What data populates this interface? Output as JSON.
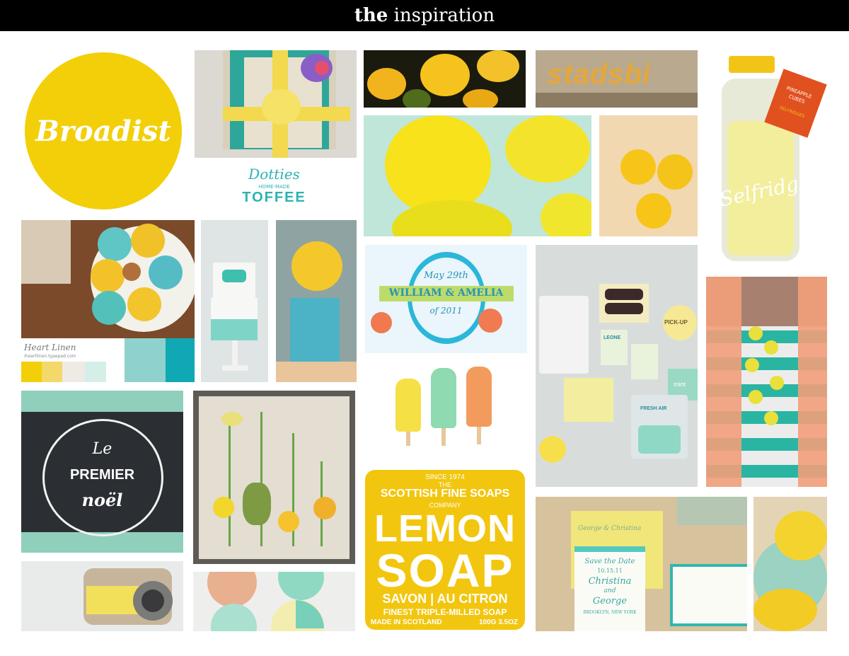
{
  "header": {
    "bold": "the",
    "rest": "inspiration"
  },
  "logo": {
    "text": "Broadist",
    "color": "#f2cf09"
  },
  "toffee": {
    "line1": "Dotties",
    "line2": "HOME-MADE",
    "line3": "TOFFEE"
  },
  "sign": {
    "text": "stadsbi"
  },
  "heartlinen": {
    "name": "Heart Linen",
    "url": "iheartlinen.typepad.com"
  },
  "wedding": {
    "date": "May 29th",
    "names": "WILLIAM & AMELIA",
    "year": "of 2011"
  },
  "jar": {
    "brand": "Selfridges",
    "tag_line1": "PINEAPPLE",
    "tag_line2": "CUBES",
    "tag_brand": "SELFRIDGES"
  },
  "window": {
    "line1": "Le",
    "line2": "PREMIER",
    "line3": "noël"
  },
  "soap": {
    "since": "SINCE 1974",
    "the": "THE",
    "brand": "SCOTTISH FINE SOAPS",
    "company": "COMPANY",
    "word1": "LEMON",
    "word2": "SOAP",
    "fr": "SAVON | AU CITRON",
    "desc": "FINEST TRIPLE-MILLED SOAP",
    "made": "MADE IN SCOTLAND",
    "weight": "100G 3.5OZ"
  },
  "candy": {
    "pickup": "PICK-UP",
    "leone": "LEONE",
    "fresh": "FRESH AIR",
    "mint": "mint"
  },
  "std": {
    "title": "Save the Date",
    "date": "10.15.11",
    "names1": "Christina",
    "and": "and",
    "names2": "George",
    "place": "BROOKLYN, NEW YORK",
    "env": "George & Christina"
  },
  "palette": [
    "#f2cf09",
    "#f8e37a",
    "#b7e0dc",
    "#10a8b4",
    "#2c2c2c"
  ]
}
